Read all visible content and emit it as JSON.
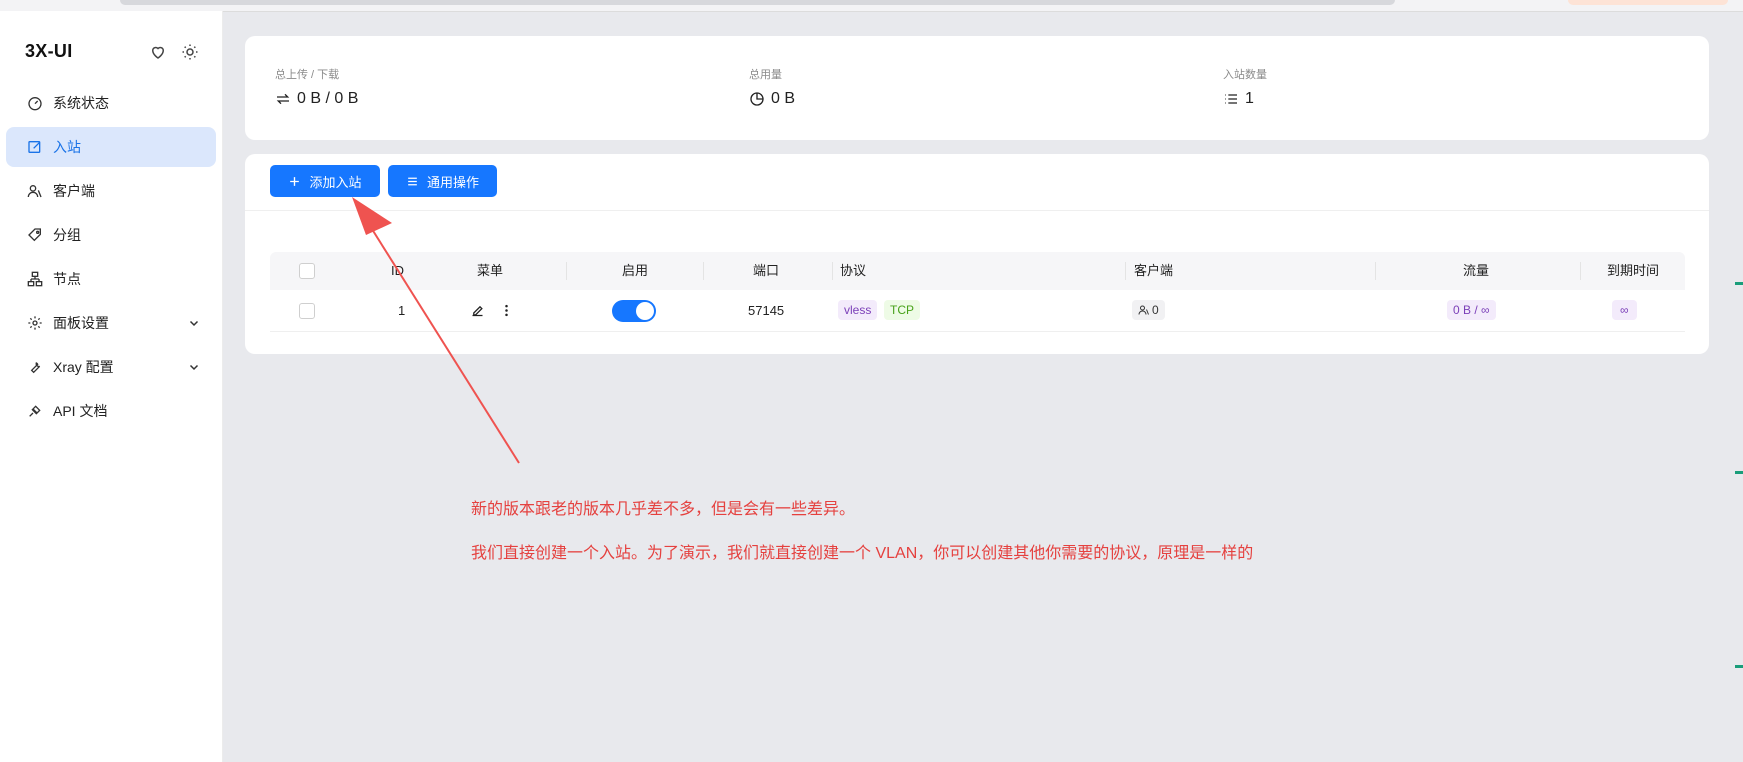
{
  "sidebar": {
    "brand": "3X-UI",
    "items": [
      {
        "label": "系统状态",
        "icon": "dashboard-icon"
      },
      {
        "label": "入站",
        "icon": "edit-icon",
        "active": true
      },
      {
        "label": "客户端",
        "icon": "users-icon"
      },
      {
        "label": "分组",
        "icon": "tag-icon"
      },
      {
        "label": "节点",
        "icon": "cluster-icon"
      },
      {
        "label": "面板设置",
        "icon": "gear-icon",
        "expandable": true
      },
      {
        "label": "Xray 配置",
        "icon": "wrench-icon",
        "expandable": true
      },
      {
        "label": "API 文档",
        "icon": "api-icon"
      }
    ]
  },
  "stats": {
    "upload_download_label": "总上传 / 下载",
    "upload_download_value": "0 B / 0 B",
    "total_usage_label": "总用量",
    "total_usage_value": "0 B",
    "inbound_count_label": "入站数量",
    "inbound_count_value": "1"
  },
  "toolbar": {
    "add_inbound": "添加入站",
    "general_actions": "通用操作"
  },
  "table": {
    "columns": [
      "ID",
      "菜单",
      "启用",
      "端口",
      "协议",
      "客户端",
      "流量",
      "到期时间"
    ],
    "rows": [
      {
        "id": "1",
        "enabled": true,
        "port": "57145",
        "protocol": "vless",
        "transport": "TCP",
        "clients": "0",
        "traffic": "0 B / ∞",
        "expiry": "∞"
      }
    ]
  },
  "annotation": {
    "line1": "新的版本跟老的版本几乎差不多，但是会有一些差异。",
    "line2": "我们直接创建一个入站。为了演示，我们就直接创建一个 VLAN，你可以创建其他你需要的协议，原理是一样的"
  },
  "colors": {
    "accent": "#1677ff",
    "annotation": "#e5413f"
  }
}
